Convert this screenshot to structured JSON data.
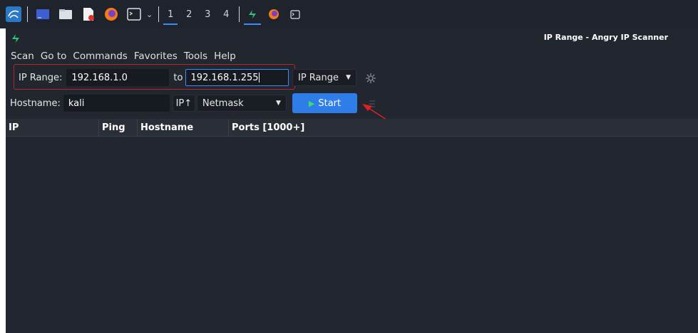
{
  "taskbar": {
    "icons": [
      "kali-menu-icon",
      "window-icon",
      "files-icon",
      "text-editor-icon",
      "firefox-icon",
      "terminal-icon"
    ],
    "workspaces": [
      "1",
      "2",
      "3",
      "4"
    ],
    "active_workspace": "1",
    "running_apps": [
      "angry-ip-scanner-icon",
      "firefox-icon",
      "terminal-icon"
    ]
  },
  "window": {
    "title": "IP Range - Angry IP Scanner"
  },
  "menu": [
    "Scan",
    "Go to",
    "Commands",
    "Favorites",
    "Tools",
    "Help"
  ],
  "range": {
    "label": "IP Range:",
    "start_value": "192.168.1.0",
    "to_label": "to",
    "end_value": "192.168.1.255",
    "feeder": "IP Range"
  },
  "host": {
    "label": "Hostname:",
    "value": "kali",
    "ip_button": "IP↑",
    "netmask": "Netmask",
    "start_label": "Start"
  },
  "table": {
    "columns": [
      "IP",
      "Ping",
      "Hostname",
      "Ports [1000+]"
    ]
  },
  "colors": {
    "accent": "#2f7de9",
    "highlight": "#b3262b",
    "annotation_arrow": "#e02020"
  }
}
